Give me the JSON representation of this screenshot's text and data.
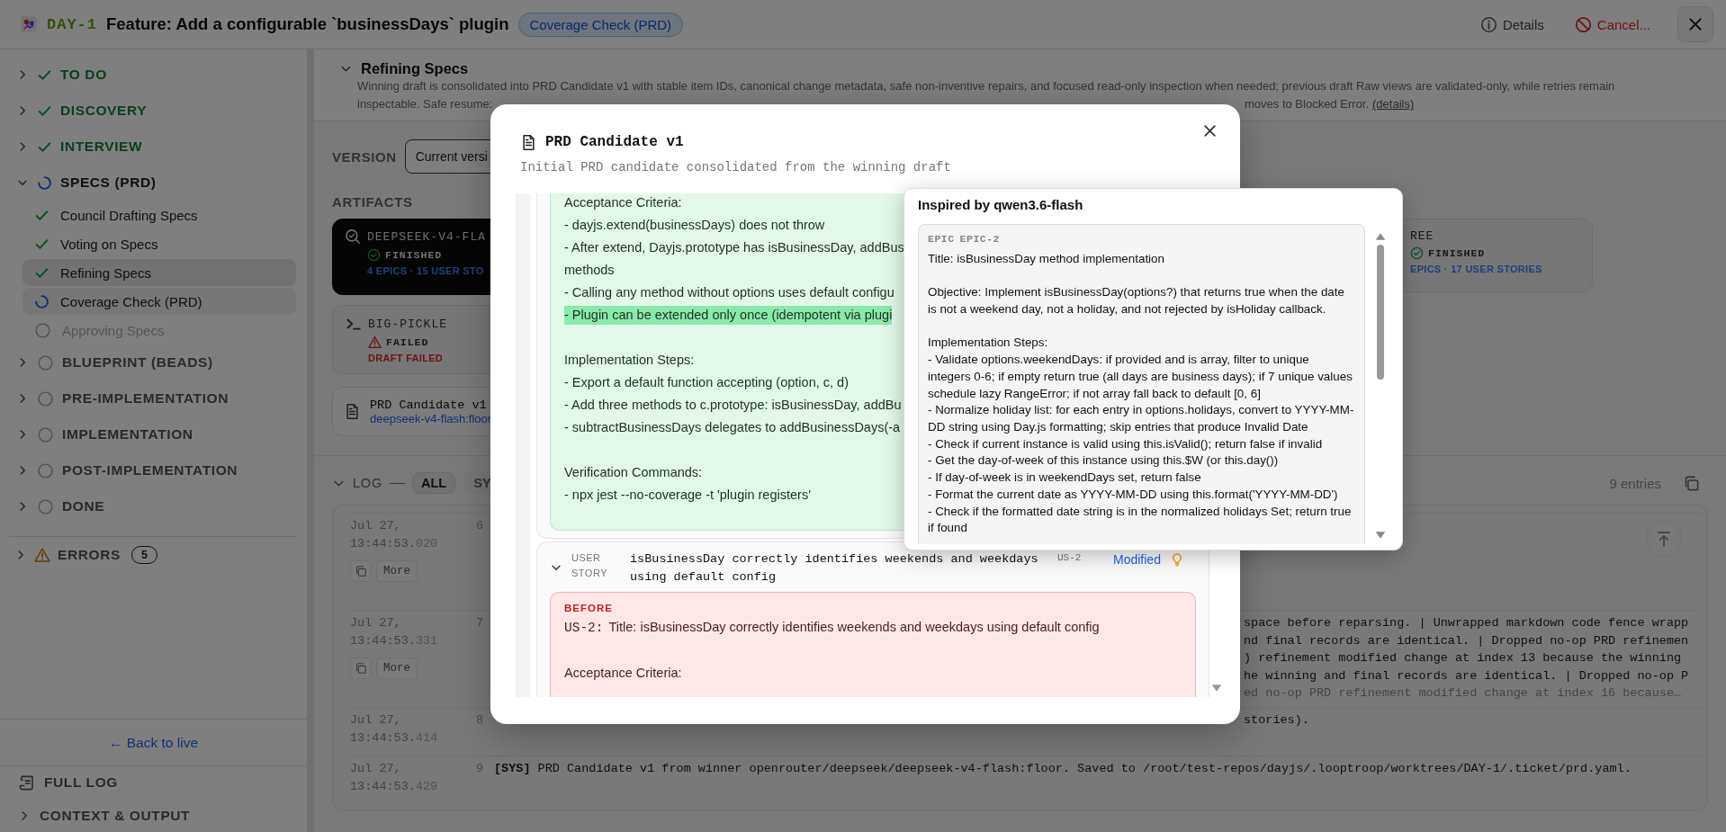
{
  "header": {
    "ticket_id": "DAY-1",
    "title": "Feature: Add a configurable `businessDays` plugin",
    "status_badge": "Coverage Check (PRD)",
    "actions": [
      {
        "kind": "details",
        "label": "Details"
      },
      {
        "kind": "cancel",
        "label": "Cancel..."
      }
    ]
  },
  "sidebar": {
    "phases": [
      {
        "label": "TO DO",
        "kind": "done",
        "expanded": false
      },
      {
        "label": "DISCOVERY",
        "kind": "done",
        "expanded": false
      },
      {
        "label": "INTERVIEW",
        "kind": "done",
        "expanded": false
      },
      {
        "label": "SPECS (PRD)",
        "kind": "active",
        "expanded": true,
        "children": [
          {
            "label": "Council Drafting Specs",
            "kind": "done",
            "selected": false
          },
          {
            "label": "Voting on Specs",
            "kind": "done",
            "selected": false
          },
          {
            "label": "Refining Specs",
            "kind": "done",
            "selected": true
          },
          {
            "label": "Coverage Check (PRD)",
            "kind": "active",
            "selected": false
          },
          {
            "label": "Approving Specs",
            "kind": "pending",
            "selected": false
          }
        ]
      },
      {
        "label": "BLUEPRINT (BEADS)",
        "kind": "pending",
        "expanded": false
      },
      {
        "label": "PRE-IMPLEMENTATION",
        "kind": "pending",
        "expanded": false
      },
      {
        "label": "IMPLEMENTATION",
        "kind": "pending",
        "expanded": false
      },
      {
        "label": "POST-IMPLEMENTATION",
        "kind": "pending",
        "expanded": false
      },
      {
        "label": "DONE",
        "kind": "pending",
        "expanded": false
      }
    ],
    "errors": {
      "label": "ERRORS",
      "count": "5",
      "expanded": false
    },
    "back_link": "← Back to live",
    "footer": [
      {
        "kind": "log",
        "label": "FULL LOG"
      },
      {
        "kind": "section",
        "label": "CONTEXT & OUTPUT",
        "expanded": false
      }
    ]
  },
  "stage": {
    "title": "Refining Specs",
    "expanded": true,
    "description": [
      "Winning draft is consolidated into PRD Candidate v1 with stable item IDs, canonical change metadata, safe non-inventive repairs, and focused read-only inspection when needed; previous draft Raw views are validated-only, while retries remain",
      "inspectable. Safe resume:",
      "moves to Blocked Error."
    ],
    "details_link": "(details)"
  },
  "version": {
    "label": "VERSION",
    "value": "Current versi"
  },
  "artifacts": {
    "label": "ARTIFACTS",
    "cards": [
      {
        "name": "DEEPSEEK-V4-FLA",
        "kind": "finished",
        "status_label": "FINISHED",
        "summary": "4 EPICS · 15 USER STO",
        "selected": true
      },
      {
        "name": "BIG-PICKLE",
        "kind": "failed",
        "status_label": "FAILED",
        "summary": "DRAFT FAILED",
        "selected": false
      },
      {
        "name": "REE",
        "kind": "finished",
        "status_label": "FINISHED",
        "summary": "EPICS · 17 USER STORIES",
        "selected": false
      }
    ],
    "document": {
      "title": "PRD Candidate v1",
      "source": "deepseek-v4-flash:floor"
    }
  },
  "log": {
    "label": "LOG",
    "filters": [
      {
        "label": "ALL",
        "selected": true
      },
      {
        "label": "SY",
        "selected": false
      }
    ],
    "count": "9 entries",
    "entries": [
      {
        "date": "Jul 27,",
        "clock": "13:44:53.",
        "ms": "020",
        "index": "6",
        "more_label": "More"
      },
      {
        "date": "Jul 27,",
        "clock": "13:44:53.",
        "ms": "331",
        "index": "7",
        "more_label": "More",
        "covered": true,
        "lines": [
          "space before reparsing. | Unwrapped markdown code fence wrapp",
          "nd final records are identical. | Dropped no-op PRD refinemen",
          ") refinement modified change at index 13 because the winning",
          "he winning and final records are identical. | Dropped no-op P"
        ],
        "fade_line": "ed no-op PRD refinement modified change at index 16 because…"
      },
      {
        "date": "Jul 27,",
        "clock": "13:44:53.",
        "ms": "414",
        "index": "8",
        "covered": true,
        "lines": [
          "stories)."
        ]
      },
      {
        "date": "Jul 27,",
        "clock": "13:44:53.",
        "ms": "429",
        "index": "9",
        "covered": false,
        "lines": [
          "**[SYS]** PRD Candidate v1 from winner openrouter/deepseek/deepseek-v4-flash:floor. Saved to /root/test-repos/dayjs/.looptroop/worktrees/DAY-1/.ticket/prd.yaml."
        ]
      }
    ]
  },
  "modal": {
    "title": "PRD Candidate v1",
    "subtitle": "Initial PRD candidate consolidated from the winning draft",
    "added": {
      "sections": [
        [
          {
            "text": "Acceptance Criteria:",
            "highlighted": false
          },
          {
            "text": "- dayjs.extend(businessDays) does not throw",
            "highlighted": false
          },
          {
            "text": "- After extend, Dayjs.prototype has isBusinessDay, addBus",
            "highlighted": false
          },
          {
            "text": "methods",
            "highlighted": false
          },
          {
            "text": "- Calling any method without options uses default configu",
            "highlighted": false
          },
          {
            "text": "- Plugin can be extended only once (idempotent via plugi",
            "highlighted": true
          }
        ],
        [
          {
            "text": "Implementation Steps:",
            "highlighted": false
          },
          {
            "text": "- Export a default function accepting (option, c, d)",
            "highlighted": false
          },
          {
            "text": "- Add three methods to c.prototype: isBusinessDay, addBu",
            "highlighted": false
          },
          {
            "text": "- subtractBusinessDays delegates to addBusinessDays(-a",
            "highlighted": false
          }
        ],
        [
          {
            "text": "Verification Commands:",
            "highlighted": false
          },
          {
            "text": "- npx jest --no-coverage -t 'plugin registers'",
            "highlighted": false
          }
        ]
      ]
    },
    "user_story": {
      "type_label": "USER STORY",
      "title": "isBusinessDay correctly identifies weekends and weekdays using default config",
      "id": "US-2",
      "change": "Modified",
      "expanded": true,
      "before": {
        "label": "BEFORE",
        "id": "US-2:",
        "title_line": "Title: isBusinessDay correctly identifies weekends and weekdays using default config",
        "lines": [
          "Acceptance Criteria:"
        ]
      }
    }
  },
  "popover": {
    "title": "Inspired by qwen3.6-flash",
    "item_type": "EPIC",
    "item_id": "EPIC-2",
    "paragraphs": [
      [
        "Title: isBusinessDay method implementation"
      ],
      [
        "Objective: Implement isBusinessDay(options?) that returns true when the date is not a weekend day, not a holiday, and not rejected by isHoliday callback."
      ],
      [
        "Implementation Steps:",
        "- Validate options.weekendDays: if provided and is array, filter to unique integers 0-6; if empty return true (all days are business days); if 7 unique values schedule lazy RangeError; if not array fall back to default [0, 6]",
        "- Normalize holiday list: for each entry in options.holidays, convert to YYYY-MM-DD string using Day.js formatting; skip entries that produce Invalid Date",
        "- Check if current instance is valid using this.isValid(); return false if invalid",
        "- Get the day-of-week of this instance using this.$W (or this.day())",
        "- If day-of-week is in weekendDays set, return false",
        "- Format the current date as YYYY-MM-DD using this.format('YYYY-MM-DD')",
        "- Check if the formatted date string is in the normalized holidays Set; return true if found"
      ]
    ]
  }
}
